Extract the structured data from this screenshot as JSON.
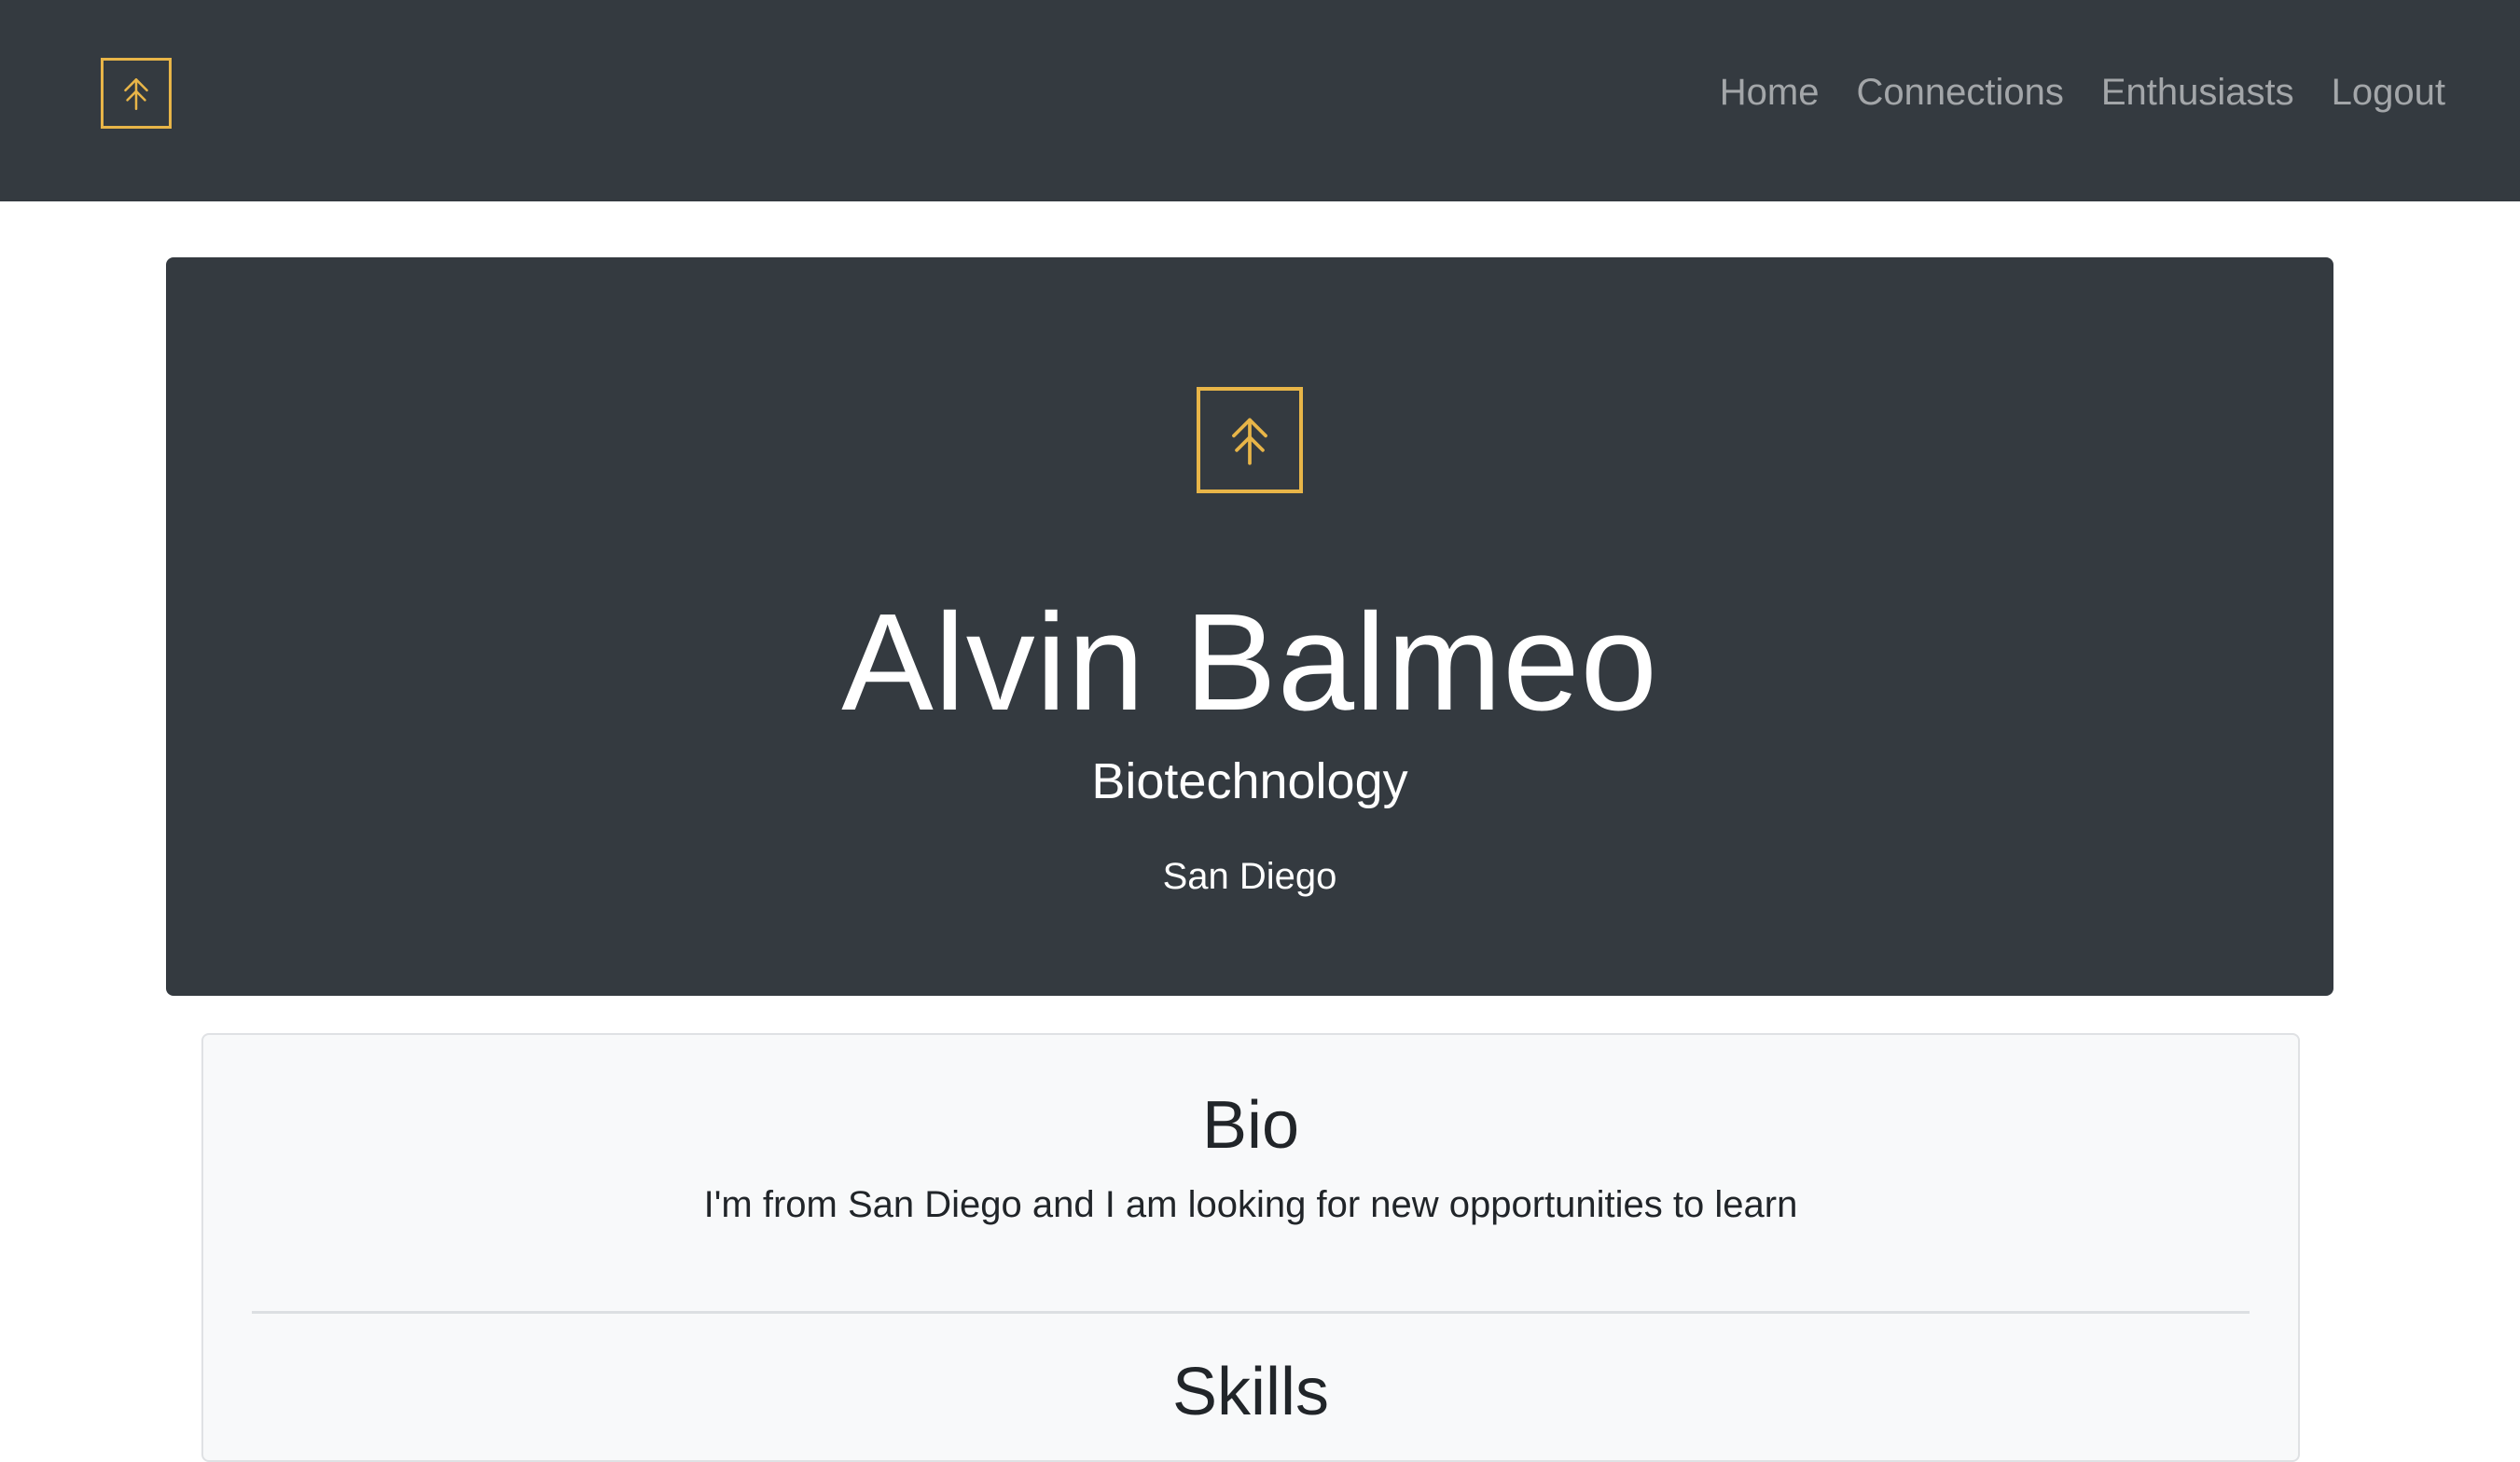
{
  "nav": {
    "brand_icon": "tree-logo-icon",
    "links": [
      "Home",
      "Connections",
      "Enthusiasts",
      "Logout"
    ]
  },
  "profile": {
    "logo_icon": "tree-logo-icon",
    "name": "Alvin Balmeo",
    "field": "Biotechnology",
    "location": "San Diego"
  },
  "bio": {
    "title": "Bio",
    "text": "I'm from San Diego and I am looking for new opportunities to learn"
  },
  "skills": {
    "title": "Skills"
  },
  "colors": {
    "navbar_bg": "#343a40",
    "accent_gold": "#e8b548",
    "card_bg": "#f8f9fa"
  }
}
